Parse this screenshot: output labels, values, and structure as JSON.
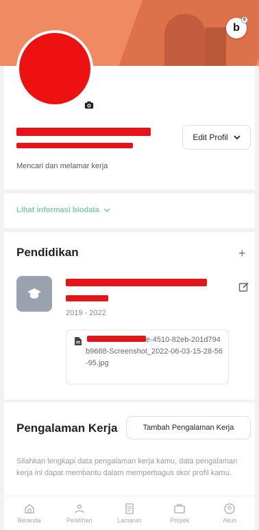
{
  "cover": {
    "badge_icon": "brand-logo-icon"
  },
  "profile": {
    "edit_label": "Edit Profil",
    "tagline": "Mencari dan melamar kerja"
  },
  "bio": {
    "link_label": "Lihat informasi biodata"
  },
  "education": {
    "title": "Pendidikan",
    "years": "2019 - 2022",
    "file_name": "e-4510-82eb-201d794b9688-Screenshot_2022-06-03-15-28-56-95.jpg"
  },
  "experience": {
    "title": "Pengalaman Kerja",
    "add_label": "Tambah Pengalaman Kerja",
    "description": "Silahkan lengkapi data pengalaman kerja kamu, data pengalaman kerja ini dapat membantu dalam memperbagus skor profil kamu."
  },
  "nav": {
    "items": [
      {
        "label": "Beranda",
        "icon": "home-icon"
      },
      {
        "label": "Pelatihan",
        "icon": "people-icon"
      },
      {
        "label": "Lamaran",
        "icon": "document-icon"
      },
      {
        "label": "Proyek",
        "icon": "briefcase-icon"
      },
      {
        "label": "Akun",
        "icon": "account-icon"
      }
    ]
  },
  "colors": {
    "cover": "#f08a63",
    "accent": "#7ecbb0",
    "redaction": "#e4141b"
  }
}
